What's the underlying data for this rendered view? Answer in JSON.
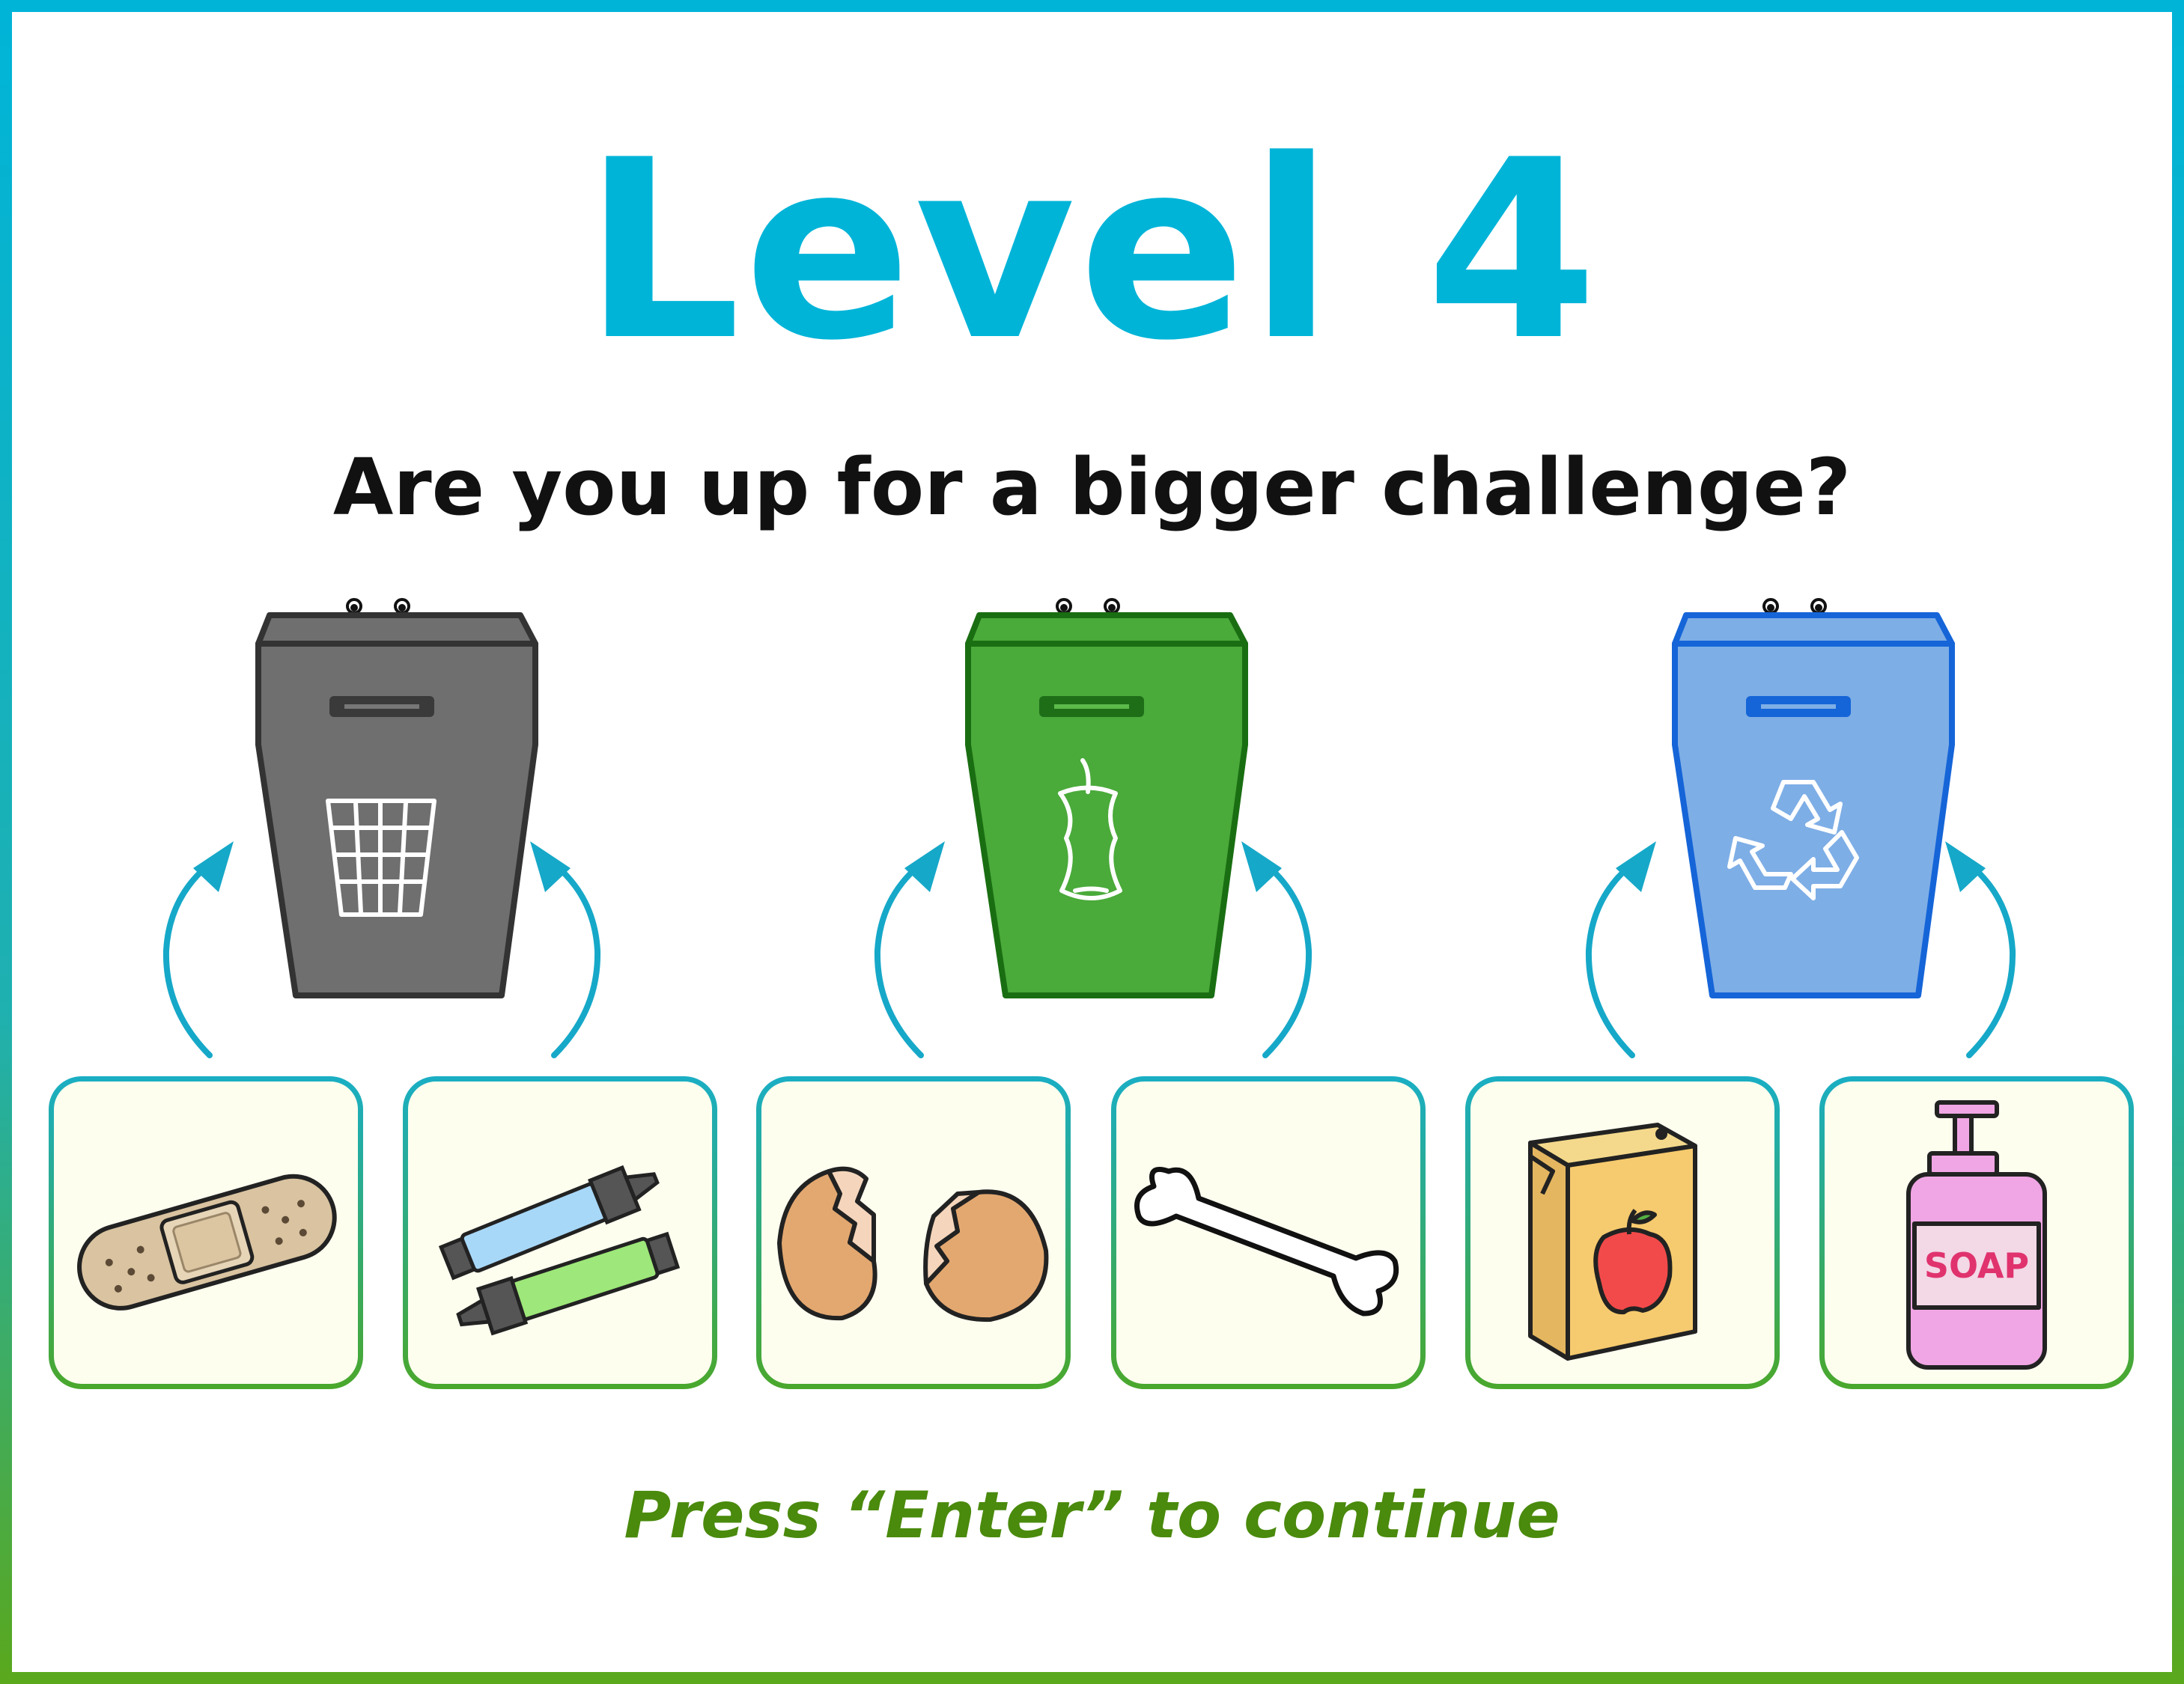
{
  "title": "Level 4",
  "subtitle": "Are you up for a bigger challenge?",
  "footer": "Press “Enter” to continue",
  "colors": {
    "accent": "#00b4d8",
    "footer": "#4a8a0c",
    "trash_bin": "#6f6f6f",
    "compost_bin": "#4aaa3a",
    "recycle_bin": "#7eaee6"
  },
  "bins": [
    {
      "name": "trash",
      "icon": "wastebasket-icon"
    },
    {
      "name": "compost",
      "icon": "apple-core-icon"
    },
    {
      "name": "recycling",
      "icon": "recycle-icon"
    }
  ],
  "items": [
    {
      "name": "bandage",
      "bin": "trash"
    },
    {
      "name": "markers",
      "bin": "trash"
    },
    {
      "name": "eggshells",
      "bin": "compost"
    },
    {
      "name": "bone",
      "bin": "compost"
    },
    {
      "name": "juice box",
      "bin": "recycling"
    },
    {
      "name": "soap bottle",
      "bin": "recycling",
      "label": "SOAP"
    }
  ]
}
